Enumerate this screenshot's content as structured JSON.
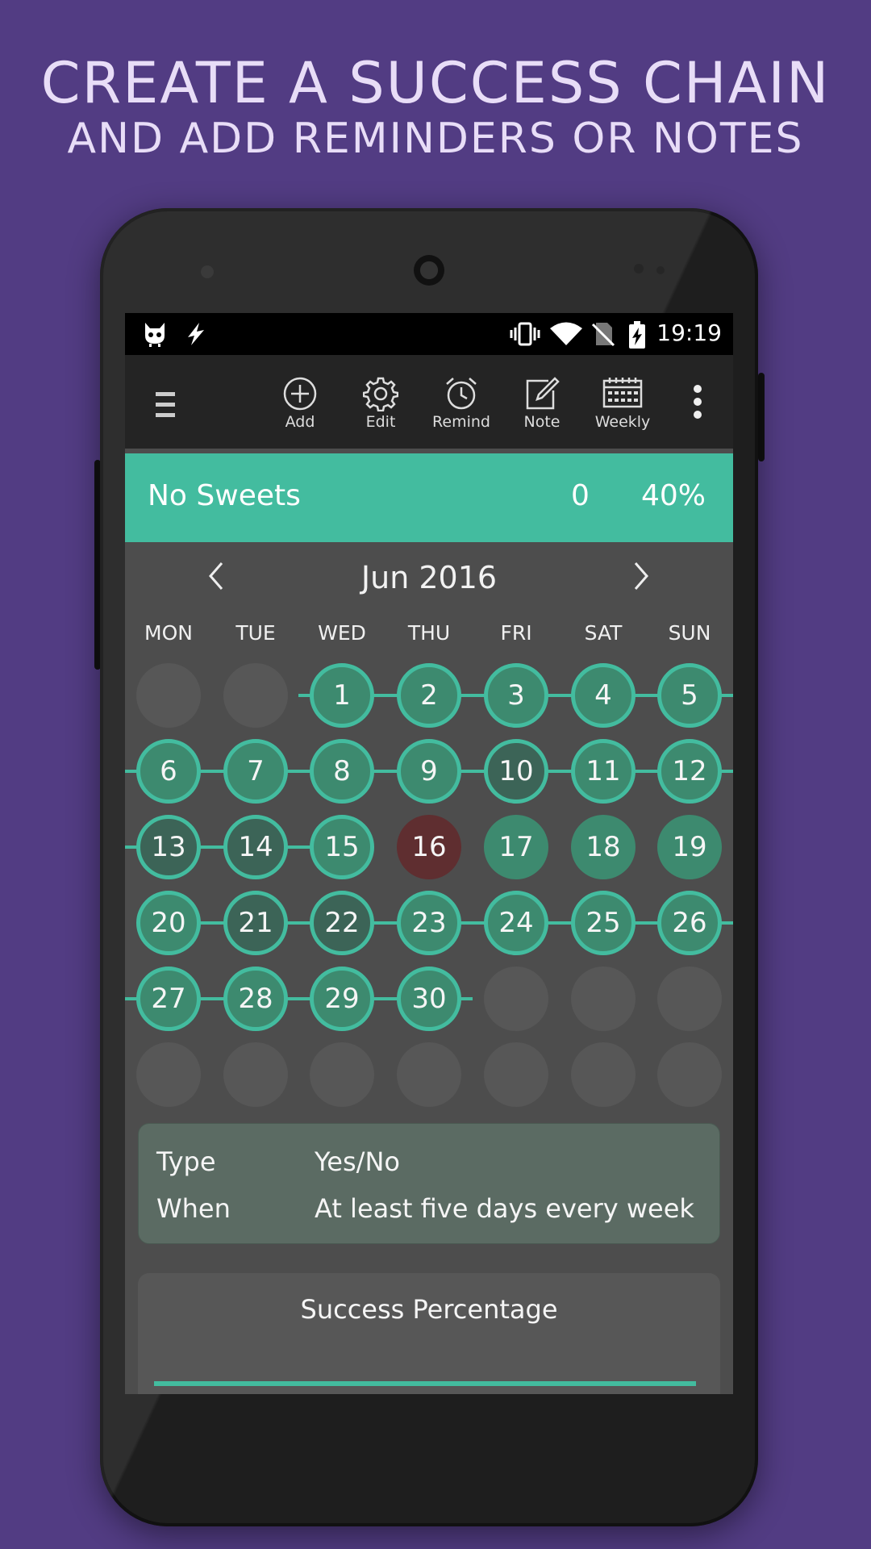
{
  "headline": {
    "line1": "CREATE A SUCCESS CHAIN",
    "line2": "AND ADD REMINDERS OR NOTES"
  },
  "status": {
    "time": "19:19",
    "icons": [
      "cyanogen-icon",
      "charging-bolt-icon",
      "vibrate-icon",
      "wifi-icon",
      "no-sim-icon",
      "battery-charging-icon"
    ]
  },
  "toolbar": {
    "menu_icon": "hamburger-icon",
    "items": [
      {
        "label": "Add",
        "icon": "add-circle-icon"
      },
      {
        "label": "Edit",
        "icon": "gear-icon"
      },
      {
        "label": "Remind",
        "icon": "alarm-clock-icon"
      },
      {
        "label": "Note",
        "icon": "note-edit-icon"
      },
      {
        "label": "Weekly",
        "icon": "calendar-grid-icon"
      }
    ],
    "more_icon": "more-vert-icon"
  },
  "habit": {
    "name": "No Sweets",
    "count": "0",
    "percent": "40%"
  },
  "calendar": {
    "month_title": "Jun 2016",
    "weekdays": [
      "MON",
      "TUE",
      "WED",
      "THU",
      "FRI",
      "SAT",
      "SUN"
    ],
    "days": [
      {
        "d": "1",
        "s": "on"
      },
      {
        "d": "2",
        "s": "on"
      },
      {
        "d": "3",
        "s": "on"
      },
      {
        "d": "4",
        "s": "on"
      },
      {
        "d": "5",
        "s": "on"
      },
      {
        "d": "6",
        "s": "on"
      },
      {
        "d": "7",
        "s": "on"
      },
      {
        "d": "8",
        "s": "on"
      },
      {
        "d": "9",
        "s": "on"
      },
      {
        "d": "10",
        "s": "dim"
      },
      {
        "d": "11",
        "s": "on"
      },
      {
        "d": "12",
        "s": "on"
      },
      {
        "d": "13",
        "s": "dim"
      },
      {
        "d": "14",
        "s": "dim"
      },
      {
        "d": "15",
        "s": "on"
      },
      {
        "d": "16",
        "s": "miss"
      },
      {
        "d": "17",
        "s": "fill"
      },
      {
        "d": "18",
        "s": "fill"
      },
      {
        "d": "19",
        "s": "fill"
      },
      {
        "d": "20",
        "s": "on"
      },
      {
        "d": "21",
        "s": "dim"
      },
      {
        "d": "22",
        "s": "dim"
      },
      {
        "d": "23",
        "s": "on"
      },
      {
        "d": "24",
        "s": "on"
      },
      {
        "d": "25",
        "s": "on"
      },
      {
        "d": "26",
        "s": "on"
      },
      {
        "d": "27",
        "s": "on"
      },
      {
        "d": "28",
        "s": "on"
      },
      {
        "d": "29",
        "s": "on"
      },
      {
        "d": "30",
        "s": "on"
      }
    ],
    "leading_empty": 2,
    "chains": [
      {
        "from": "1",
        "to": "5",
        "extend_left": true,
        "extend_right": true
      },
      {
        "from": "6",
        "to": "12",
        "extend_left": true,
        "extend_right": true
      },
      {
        "from": "13",
        "to": "15",
        "extend_left": true,
        "extend_right": false
      },
      {
        "from": "20",
        "to": "26",
        "extend_left": false,
        "extend_right": true
      },
      {
        "from": "27",
        "to": "30",
        "extend_left": true,
        "extend_right": true
      }
    ]
  },
  "info": {
    "type_label": "Type",
    "type_value": "Yes/No",
    "when_label": "When",
    "when_value": "At least five days every week"
  },
  "success": {
    "title": "Success Percentage",
    "fraction": 1.0
  },
  "colors": {
    "accent": "#43bc9f",
    "background": "#523c83",
    "miss": "#5f2e30"
  }
}
